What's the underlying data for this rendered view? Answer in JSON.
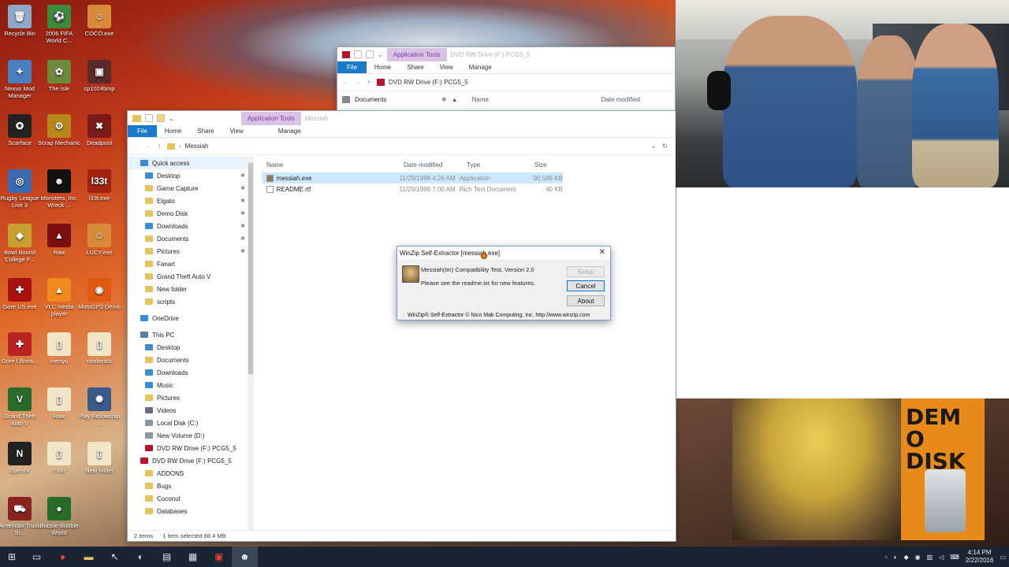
{
  "desktop_icons": [
    {
      "label": "Recycle Bin",
      "glyph": "🗑"
    },
    {
      "label": "2006 FIFA World C...",
      "glyph": "⚽"
    },
    {
      "label": "COCO.exe",
      "glyph": "☺"
    },
    {
      "label": "Nexus Mod Manager",
      "glyph": "✦"
    },
    {
      "label": "The Isle",
      "glyph": "✿"
    },
    {
      "label": "cp1024bmp",
      "glyph": "▣"
    },
    {
      "label": "Scarface",
      "glyph": "✪"
    },
    {
      "label": "Scrap Mechanic",
      "glyph": "⚙"
    },
    {
      "label": "Deadpool",
      "glyph": "✖"
    },
    {
      "label": "Rugby League Live 3",
      "glyph": "◎"
    },
    {
      "label": "Monsters, Inc. Wreck ...",
      "glyph": "☻"
    },
    {
      "label": "l33t.exe",
      "glyph": "l33t"
    },
    {
      "label": "Bowl Bound College F...",
      "glyph": "◆"
    },
    {
      "label": "Raw",
      "glyph": "▲"
    },
    {
      "label": "LUCY.exe",
      "glyph": "☺"
    },
    {
      "label": "Gore US.exe",
      "glyph": "✚"
    },
    {
      "label": "VLC media player",
      "glyph": "▲"
    },
    {
      "label": "MotoGP2 Demo",
      "glyph": "◉"
    },
    {
      "label": "Gore Ultima...",
      "glyph": "✚"
    },
    {
      "label": "menyo",
      "glyph": "▯"
    },
    {
      "label": "nosferatu",
      "glyph": "▯"
    },
    {
      "label": "Grand Theft Auto V",
      "glyph": "V"
    },
    {
      "label": "Raw",
      "glyph": "▯"
    },
    {
      "label": "Play Fellowship ...",
      "glyph": "✺"
    },
    {
      "label": "OpenIV",
      "glyph": "N"
    },
    {
      "label": "Tron",
      "glyph": "▯"
    },
    {
      "label": "New folder",
      "glyph": "▯"
    },
    {
      "label": "American Truck Si...",
      "glyph": "⛟"
    },
    {
      "label": "Bubble Bobble World",
      "glyph": "●"
    }
  ],
  "back_window": {
    "app_tools": "Application Tools",
    "title": "DVD RW Drive (F:) PCG5_5",
    "tabs": [
      "File",
      "Home",
      "Share",
      "View",
      "Manage"
    ],
    "address": "DVD RW Drive (F:) PCG5_5",
    "nav_first": "Documents",
    "col_name": "Name",
    "col_date": "Date modified"
  },
  "front_window": {
    "app_tools": "Application Tools",
    "title": "Messiah",
    "tabs": [
      "File",
      "Home",
      "Share",
      "View",
      "Manage"
    ],
    "address": "Messiah",
    "nav": [
      {
        "label": "Quick access",
        "kind": "star",
        "indent": 0,
        "pin": false
      },
      {
        "label": "Desktop",
        "kind": "blue",
        "indent": 1,
        "pin": true
      },
      {
        "label": "Game Capture",
        "kind": "folder",
        "indent": 1,
        "pin": true
      },
      {
        "label": "Elgato",
        "kind": "folder",
        "indent": 1,
        "pin": true
      },
      {
        "label": "Demo Disk",
        "kind": "folder",
        "indent": 1,
        "pin": true
      },
      {
        "label": "Downloads",
        "kind": "blue",
        "indent": 1,
        "pin": true
      },
      {
        "label": "Documents",
        "kind": "folder",
        "indent": 1,
        "pin": true
      },
      {
        "label": "Pictures",
        "kind": "folder",
        "indent": 1,
        "pin": true
      },
      {
        "label": "Fanart",
        "kind": "folder",
        "indent": 1,
        "pin": false
      },
      {
        "label": "Grand Theft Auto V",
        "kind": "folder",
        "indent": 1,
        "pin": false
      },
      {
        "label": "New folder",
        "kind": "folder",
        "indent": 1,
        "pin": false
      },
      {
        "label": "scripts",
        "kind": "folder",
        "indent": 1,
        "pin": false
      },
      {
        "label": "",
        "kind": "gap",
        "indent": 0,
        "pin": false
      },
      {
        "label": "OneDrive",
        "kind": "cloud",
        "indent": 0,
        "pin": false
      },
      {
        "label": "",
        "kind": "gap",
        "indent": 0,
        "pin": false
      },
      {
        "label": "This PC",
        "kind": "pc",
        "indent": 0,
        "pin": false
      },
      {
        "label": "Desktop",
        "kind": "blue",
        "indent": 1,
        "pin": false
      },
      {
        "label": "Documents",
        "kind": "folder",
        "indent": 1,
        "pin": false
      },
      {
        "label": "Downloads",
        "kind": "blue",
        "indent": 1,
        "pin": false
      },
      {
        "label": "Music",
        "kind": "music",
        "indent": 1,
        "pin": false
      },
      {
        "label": "Pictures",
        "kind": "folder",
        "indent": 1,
        "pin": false
      },
      {
        "label": "Videos",
        "kind": "video",
        "indent": 1,
        "pin": false
      },
      {
        "label": "Local Disk (C:)",
        "kind": "drive",
        "indent": 1,
        "pin": false
      },
      {
        "label": "New Volume (D:)",
        "kind": "drive",
        "indent": 1,
        "pin": false
      },
      {
        "label": "DVD RW Drive (F:) PCG5_5",
        "kind": "dvd",
        "indent": 1,
        "pin": false
      },
      {
        "label": "DVD RW Drive (F:) PCG5_5",
        "kind": "dvd",
        "indent": 0,
        "pin": false
      },
      {
        "label": "ADDONS",
        "kind": "folder",
        "indent": 1,
        "pin": false
      },
      {
        "label": "Bugs",
        "kind": "folder",
        "indent": 1,
        "pin": false
      },
      {
        "label": "Coconut",
        "kind": "folder",
        "indent": 1,
        "pin": false
      },
      {
        "label": "Databases",
        "kind": "folder",
        "indent": 1,
        "pin": false
      }
    ],
    "columns": {
      "name": "Name",
      "date": "Date modified",
      "type": "Type",
      "size": "Size"
    },
    "files": [
      {
        "name": "messiah.exe",
        "date": "11/29/1999 4:26 AM",
        "type": "Application",
        "size": "90,588 KB",
        "selected": true
      },
      {
        "name": "README.rtf",
        "date": "11/29/1999 7:00 AM",
        "type": "Rich Text Document",
        "size": "40 KB",
        "selected": false
      }
    ],
    "status": {
      "items": "2 items",
      "selection": "1 item selected  88.4 MB"
    }
  },
  "dialog": {
    "title": "WinZip Self-Extractor [messiah.exe]",
    "line1": "Messiah(tm) Compatibility Test, Version 2.0",
    "line2": "Please see the readme.txt for new features.",
    "setup": "Setup",
    "cancel": "Cancel",
    "about": "About",
    "footer": "WinZip® Self-Extractor  © Nico Mak Computing, Inc.   http://www.winzip.com"
  },
  "overlay": {
    "demo_disk": "DEMO DISK"
  },
  "taskbar": {
    "time": "4:14 PM",
    "date": "2/22/2016",
    "accent": "#1b2433"
  },
  "colors": {
    "file_tab": "#1979ca",
    "app_tools": "#d9c2e6",
    "selection": "#cce8ff"
  }
}
